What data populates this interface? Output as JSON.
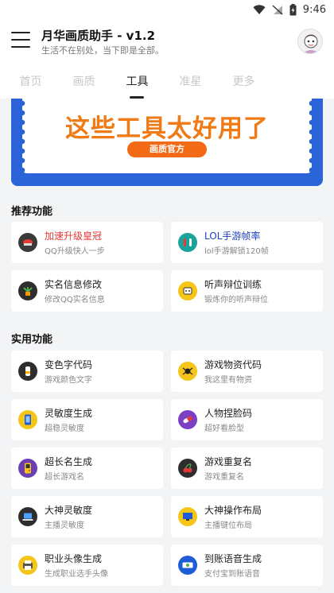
{
  "status_bar": {
    "time": "9:46"
  },
  "header": {
    "title": "月华画质助手 - v1.2",
    "subtitle": "生活不在别处，当下即是全部。"
  },
  "tabs": [
    {
      "label": "首页"
    },
    {
      "label": "画质"
    },
    {
      "label": "工具",
      "active": true
    },
    {
      "label": "准星"
    },
    {
      "label": "更多"
    }
  ],
  "banner": {
    "headline": "这些工具太好用了",
    "badge": "画质官方"
  },
  "sections": {
    "recommended": {
      "title": "推荐功能",
      "items": [
        {
          "title": "加速升级皇冠",
          "desc": "QQ升级快人一步",
          "title_color": "#e53935",
          "icon": "crown-icon"
        },
        {
          "title": "LOL手游帧率",
          "desc": "lol手游解锁120帧",
          "title_color": "#1e3fbf",
          "icon": "flask-icon"
        },
        {
          "title": "实名信息修改",
          "desc": "修改QQ实名信息",
          "title_color": "#222222",
          "icon": "plant-icon"
        },
        {
          "title": "听声辩位训练",
          "desc": "锻炼你的听声辩位",
          "title_color": "#222222",
          "icon": "robot-icon"
        }
      ]
    },
    "utility": {
      "title": "实用功能",
      "items": [
        {
          "title": "变色字代码",
          "desc": "游戏颜色文字",
          "icon": "bottle-icon"
        },
        {
          "title": "游戏物资代码",
          "desc": "我这里有物资",
          "icon": "spider-icon"
        },
        {
          "title": "灵敏度生成",
          "desc": "超稳灵敏度",
          "icon": "phone-icon"
        },
        {
          "title": "人物捏脸码",
          "desc": "超好看脸型",
          "icon": "pill-icon"
        },
        {
          "title": "超长名生成",
          "desc": "超长游戏名",
          "icon": "gameboy-icon"
        },
        {
          "title": "游戏重复名",
          "desc": "游戏重复名",
          "icon": "cherry-icon"
        },
        {
          "title": "大神灵敏度",
          "desc": "主播灵敏度",
          "icon": "laptop-icon"
        },
        {
          "title": "大神操作布局",
          "desc": "主播键位布局",
          "icon": "monitor-icon"
        },
        {
          "title": "职业头像生成",
          "desc": "生成职业选手头像",
          "icon": "printer-icon"
        },
        {
          "title": "到账语音生成",
          "desc": "支付宝到账语音",
          "icon": "money-icon"
        }
      ]
    }
  },
  "colors": {
    "accent": "#222222",
    "banner_blue": "#2a64d8",
    "banner_orange": "#f07a16",
    "tab_inactive": "#c8c8c8"
  }
}
